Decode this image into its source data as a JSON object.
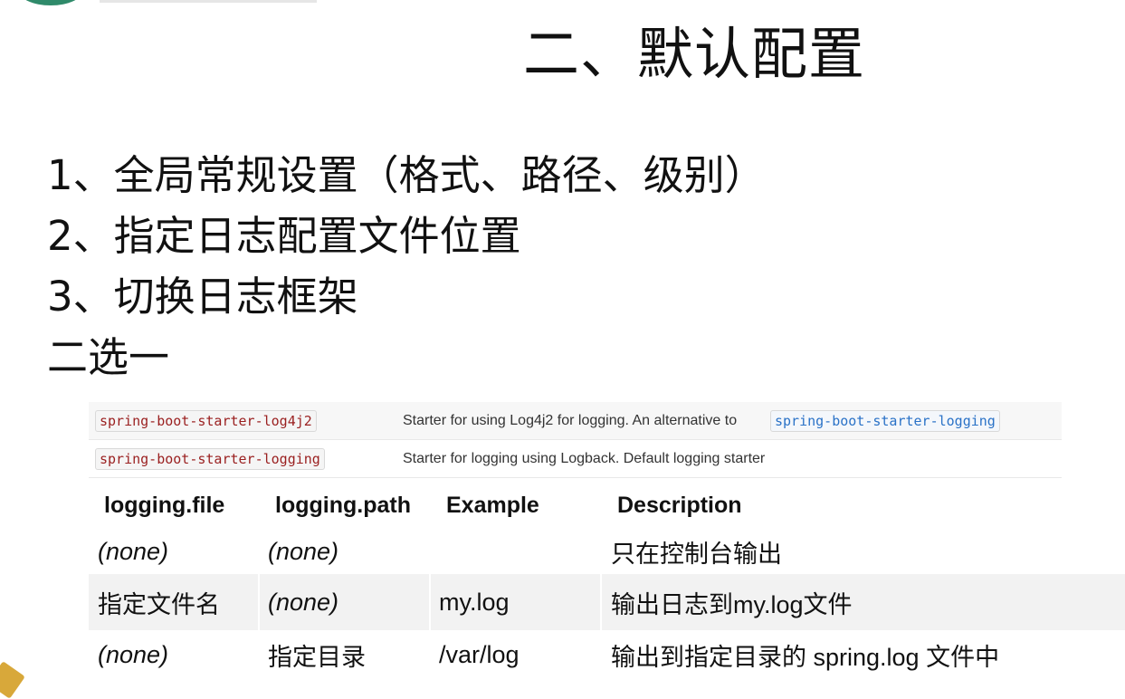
{
  "slide": {
    "title": "二、默认配置",
    "agenda": [
      "1、全局常规设置（格式、路径、级别）",
      "2、指定日志配置文件位置",
      "3、切换日志框架",
      "二选一"
    ]
  },
  "starters": {
    "rows": [
      {
        "name": "spring-boot-starter-log4j2",
        "description": "Starter for using Log4j2 for logging. An alternative to",
        "link": "spring-boot-starter-logging"
      },
      {
        "name": "spring-boot-starter-logging",
        "description": "Starter for logging using Logback. Default logging starter"
      }
    ]
  },
  "logging_table": {
    "headers": [
      "logging.file",
      "logging.path",
      "Example",
      "Description"
    ],
    "rows": [
      [
        "(none)",
        "(none)",
        "",
        "只在控制台输出"
      ],
      [
        "指定文件名",
        "(none)",
        "my.log",
        "输出日志到my.log文件"
      ],
      [
        "(none)",
        "指定目录",
        "/var/log",
        "输出到指定目录的 spring.log 文件中"
      ]
    ]
  },
  "colors": {
    "code_text": "#9a1f1f",
    "link_text": "#2a72c7",
    "deco_green": "#2f8a6a",
    "deco_gold": "#d8a83a",
    "row_highlight": "#f2f2f2"
  }
}
